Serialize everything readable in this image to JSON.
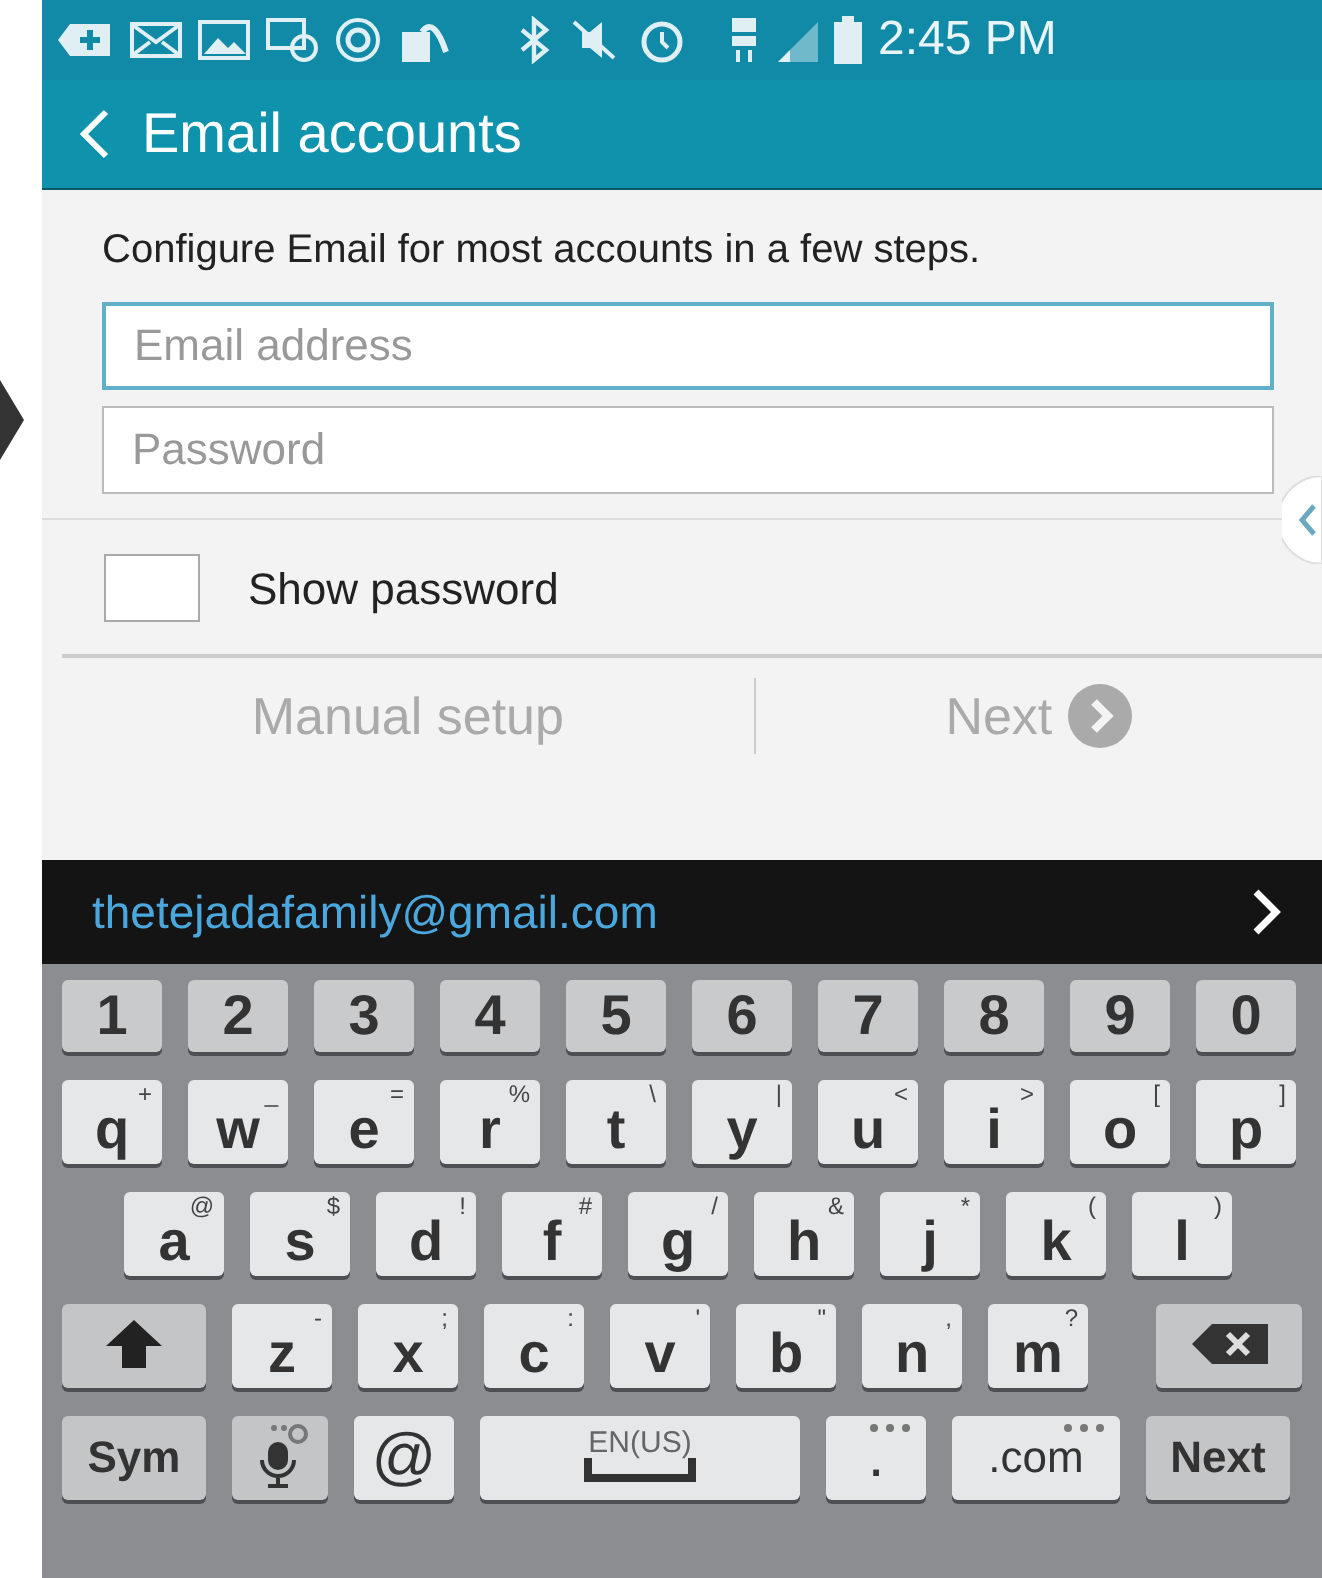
{
  "status_bar": {
    "time": "2:45 PM"
  },
  "app_bar": {
    "title": "Email accounts"
  },
  "intro": "Configure Email for most accounts in a few steps.",
  "fields": [
    {
      "placeholder": "Email address",
      "focused": true
    },
    {
      "placeholder": "Password",
      "focused": false
    }
  ],
  "show_password": {
    "label": "Show password",
    "checked": false
  },
  "actions": [
    {
      "label": "Manual setup",
      "kind": "text",
      "disabled": true
    },
    {
      "label": "Next",
      "kind": "next",
      "disabled": true
    }
  ],
  "suggestion": {
    "text": "thetejadafamily@gmail.com"
  },
  "keyboard": [
    [
      {
        "label": "1",
        "kind": "num"
      },
      {
        "label": "2",
        "kind": "num"
      },
      {
        "label": "3",
        "kind": "num"
      },
      {
        "label": "4",
        "kind": "num"
      },
      {
        "label": "5",
        "kind": "num"
      },
      {
        "label": "6",
        "kind": "num"
      },
      {
        "label": "7",
        "kind": "num"
      },
      {
        "label": "8",
        "kind": "num"
      },
      {
        "label": "9",
        "kind": "num"
      },
      {
        "label": "0",
        "kind": "num"
      }
    ],
    [
      {
        "label": "q",
        "hint": "+",
        "kind": "char"
      },
      {
        "label": "w",
        "hint": "_",
        "kind": "char"
      },
      {
        "label": "e",
        "hint": "=",
        "kind": "char"
      },
      {
        "label": "r",
        "hint": "%",
        "kind": "char"
      },
      {
        "label": "t",
        "hint": "\\",
        "kind": "char"
      },
      {
        "label": "y",
        "hint": "|",
        "kind": "char"
      },
      {
        "label": "u",
        "hint": "<",
        "kind": "char"
      },
      {
        "label": "i",
        "hint": ">",
        "kind": "char"
      },
      {
        "label": "o",
        "hint": "[",
        "kind": "char"
      },
      {
        "label": "p",
        "hint": "]",
        "kind": "char"
      }
    ],
    [
      {
        "label": "a",
        "hint": "@",
        "kind": "char"
      },
      {
        "label": "s",
        "hint": "$",
        "kind": "char"
      },
      {
        "label": "d",
        "hint": "!",
        "kind": "char"
      },
      {
        "label": "f",
        "hint": "#",
        "kind": "char"
      },
      {
        "label": "g",
        "hint": "/",
        "kind": "char"
      },
      {
        "label": "h",
        "hint": "&",
        "kind": "char"
      },
      {
        "label": "j",
        "hint": "*",
        "kind": "char"
      },
      {
        "label": "k",
        "hint": "(",
        "kind": "char"
      },
      {
        "label": "l",
        "hint": ")",
        "kind": "char"
      }
    ],
    [
      {
        "kind": "shift"
      },
      {
        "label": "z",
        "hint": "-",
        "kind": "char"
      },
      {
        "label": "x",
        "hint": ";",
        "kind": "char"
      },
      {
        "label": "c",
        "hint": ":",
        "kind": "char"
      },
      {
        "label": "v",
        "hint": "'",
        "kind": "char"
      },
      {
        "label": "b",
        "hint": "\"",
        "kind": "char"
      },
      {
        "label": "n",
        "hint": ",",
        "kind": "char"
      },
      {
        "label": "m",
        "hint": "?",
        "kind": "char"
      },
      {
        "kind": "backspace"
      }
    ],
    [
      {
        "label": "Sym",
        "kind": "func"
      },
      {
        "kind": "mic"
      },
      {
        "label": "@",
        "kind": "char"
      },
      {
        "label": "EN(US)",
        "kind": "space"
      },
      {
        "label": ".",
        "kind": "dots"
      },
      {
        "label": ".com",
        "kind": "dots"
      },
      {
        "label": "Next",
        "kind": "func"
      }
    ]
  ]
}
